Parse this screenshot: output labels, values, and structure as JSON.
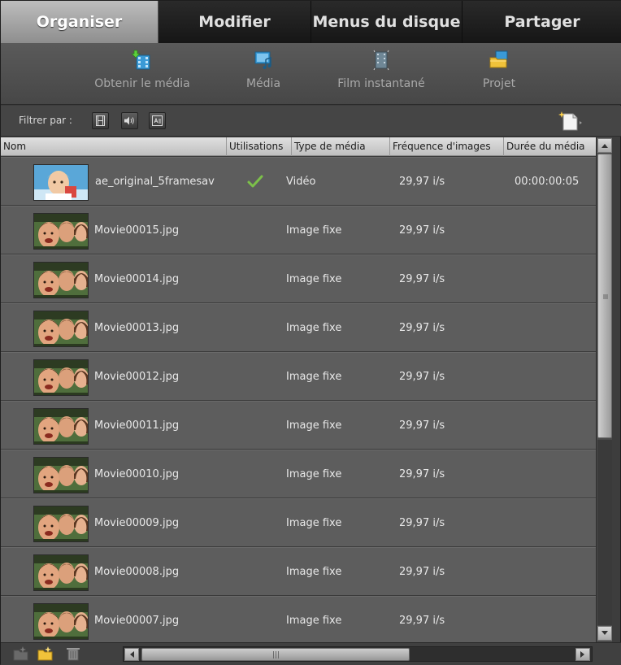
{
  "tabs": [
    {
      "label": "Organiser",
      "active": true
    },
    {
      "label": "Modifier",
      "active": false
    },
    {
      "label": "Menus du disque",
      "active": false
    },
    {
      "label": "Partager",
      "active": false
    }
  ],
  "subtabs": [
    {
      "label": "Obtenir le média",
      "icon": "get-media-icon",
      "active": false
    },
    {
      "label": "Média",
      "icon": "media-icon",
      "active": false
    },
    {
      "label": "Film instantané",
      "icon": "instant-movie-icon",
      "active": false
    },
    {
      "label": "Projet",
      "icon": "project-icon",
      "active": true
    }
  ],
  "filter": {
    "label": "Filtrer par :",
    "buttons": [
      "filter-video-icon",
      "filter-audio-icon",
      "filter-title-icon"
    ],
    "new_item_icon": "new-item-icon"
  },
  "columns": {
    "name": "Nom",
    "uses": "Utilisations",
    "type": "Type de média",
    "framerate": "Fréquence d'images",
    "duration": "Durée du média"
  },
  "rows": [
    {
      "name": "ae_original_5framesav",
      "used": true,
      "type": "Vidéo",
      "framerate": "29,97 i/s",
      "duration": "00:00:00:05",
      "thumb": "child-photo"
    },
    {
      "name": "Movie00015.jpg",
      "used": false,
      "type": "Image fixe",
      "framerate": "29,97 i/s",
      "duration": "",
      "thumb": "group-photo"
    },
    {
      "name": "Movie00014.jpg",
      "used": false,
      "type": "Image fixe",
      "framerate": "29,97 i/s",
      "duration": "",
      "thumb": "group-photo"
    },
    {
      "name": "Movie00013.jpg",
      "used": false,
      "type": "Image fixe",
      "framerate": "29,97 i/s",
      "duration": "",
      "thumb": "group-photo"
    },
    {
      "name": "Movie00012.jpg",
      "used": false,
      "type": "Image fixe",
      "framerate": "29,97 i/s",
      "duration": "",
      "thumb": "group-photo"
    },
    {
      "name": "Movie00011.jpg",
      "used": false,
      "type": "Image fixe",
      "framerate": "29,97 i/s",
      "duration": "",
      "thumb": "group-photo"
    },
    {
      "name": "Movie00010.jpg",
      "used": false,
      "type": "Image fixe",
      "framerate": "29,97 i/s",
      "duration": "",
      "thumb": "group-photo"
    },
    {
      "name": "Movie00009.jpg",
      "used": false,
      "type": "Image fixe",
      "framerate": "29,97 i/s",
      "duration": "",
      "thumb": "group-photo"
    },
    {
      "name": "Movie00008.jpg",
      "used": false,
      "type": "Image fixe",
      "framerate": "29,97 i/s",
      "duration": "",
      "thumb": "group-photo"
    },
    {
      "name": "Movie00007.jpg",
      "used": false,
      "type": "Image fixe",
      "framerate": "29,97 i/s",
      "duration": "",
      "thumb": "group-photo"
    }
  ],
  "bottom_icons": [
    "new-folder-icon",
    "folder-icon",
    "trash-icon"
  ],
  "colors": {
    "active_tab": "#a6a6a6",
    "row_bg": "#5d5d5d",
    "check": "#7cc04a"
  }
}
